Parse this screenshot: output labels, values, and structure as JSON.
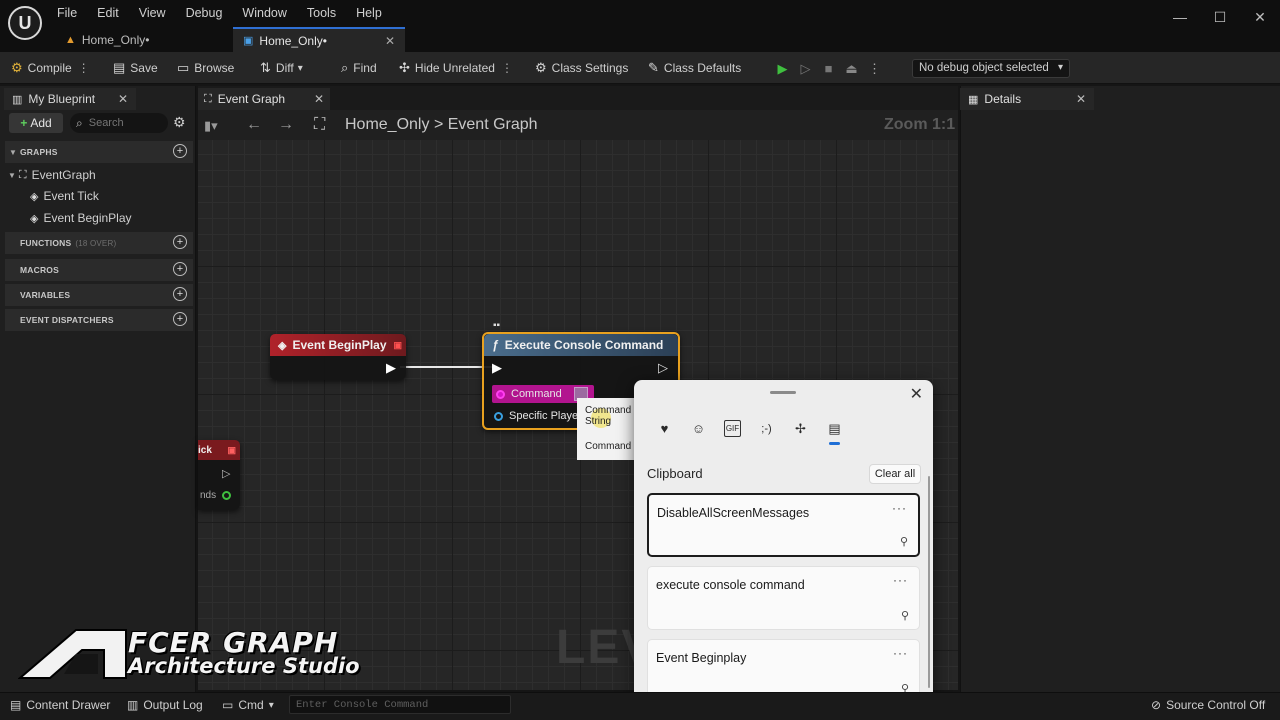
{
  "menubar": {
    "items": [
      "File",
      "Edit",
      "View",
      "Debug",
      "Window",
      "Tools",
      "Help"
    ]
  },
  "window_controls": {
    "minimize": "—",
    "maximize": "☐",
    "close": "✕"
  },
  "doc_tabs": [
    {
      "label": "Home_Only•"
    },
    {
      "label": "Home_Only•"
    }
  ],
  "toolbar": {
    "compile": "Compile",
    "save": "Save",
    "browse": "Browse",
    "diff": "Diff",
    "find": "Find",
    "hide_unrelated": "Hide Unrelated",
    "class_settings": "Class Settings",
    "class_defaults": "Class Defaults",
    "debug_object": "No debug object selected"
  },
  "my_blueprint": {
    "tab_label": "My Blueprint",
    "add_label": "Add",
    "search_placeholder": "Search",
    "sections": {
      "graphs": "GRAPHS",
      "functions": "FUNCTIONS",
      "functions_count": "(18 OVER)",
      "macros": "MACROS",
      "variables": "VARIABLES",
      "event_dispatchers": "EVENT DISPATCHERS"
    },
    "tree": {
      "event_graph": "EventGraph",
      "event_tick": "Event Tick",
      "event_beginplay": "Event BeginPlay"
    }
  },
  "graph": {
    "tab_label": "Event Graph",
    "breadcrumb_root": "Home_Only",
    "breadcrumb_sep": ">",
    "breadcrumb_current": "Event Graph",
    "zoom": "Zoom 1:1",
    "watermark": "LEV",
    "nodes": {
      "begin_play": {
        "title": "Event BeginPlay"
      },
      "exec_console": {
        "title": "Execute Console Command",
        "pin_command": "Command",
        "pin_player": "Specific Player"
      },
      "partial_left": {
        "title_frag": "ick",
        "pin_frag": "nds"
      }
    },
    "pin_dropdown": {
      "option1_line1": "Command",
      "option1_line2": "String",
      "option2": "Command"
    }
  },
  "clipboard": {
    "title": "Clipboard",
    "clear_all": "Clear all",
    "items": [
      {
        "text": "DisableAllScreenMessages"
      },
      {
        "text": "execute console command"
      },
      {
        "text": "Event Beginplay"
      }
    ],
    "more": "···"
  },
  "brand": {
    "line1": "FCER GRAPH",
    "line2": "Architecture Studio"
  },
  "details": {
    "tab_label": "Details"
  },
  "statusbar": {
    "content_drawer": "Content Drawer",
    "output_log": "Output Log",
    "cmd": "Cmd",
    "console_placeholder": "Enter Console Command",
    "source_control": "Source Control Off"
  },
  "colors": {
    "event_node_header": "#a31d24",
    "function_node_header": "#3b5a7a",
    "selection_outline": "#e8a11f",
    "string_pin": "#d615c8",
    "object_pin": "#3aa0e0",
    "play_green": "#3fbf3f",
    "accent_blue": "#2f6fd3"
  }
}
